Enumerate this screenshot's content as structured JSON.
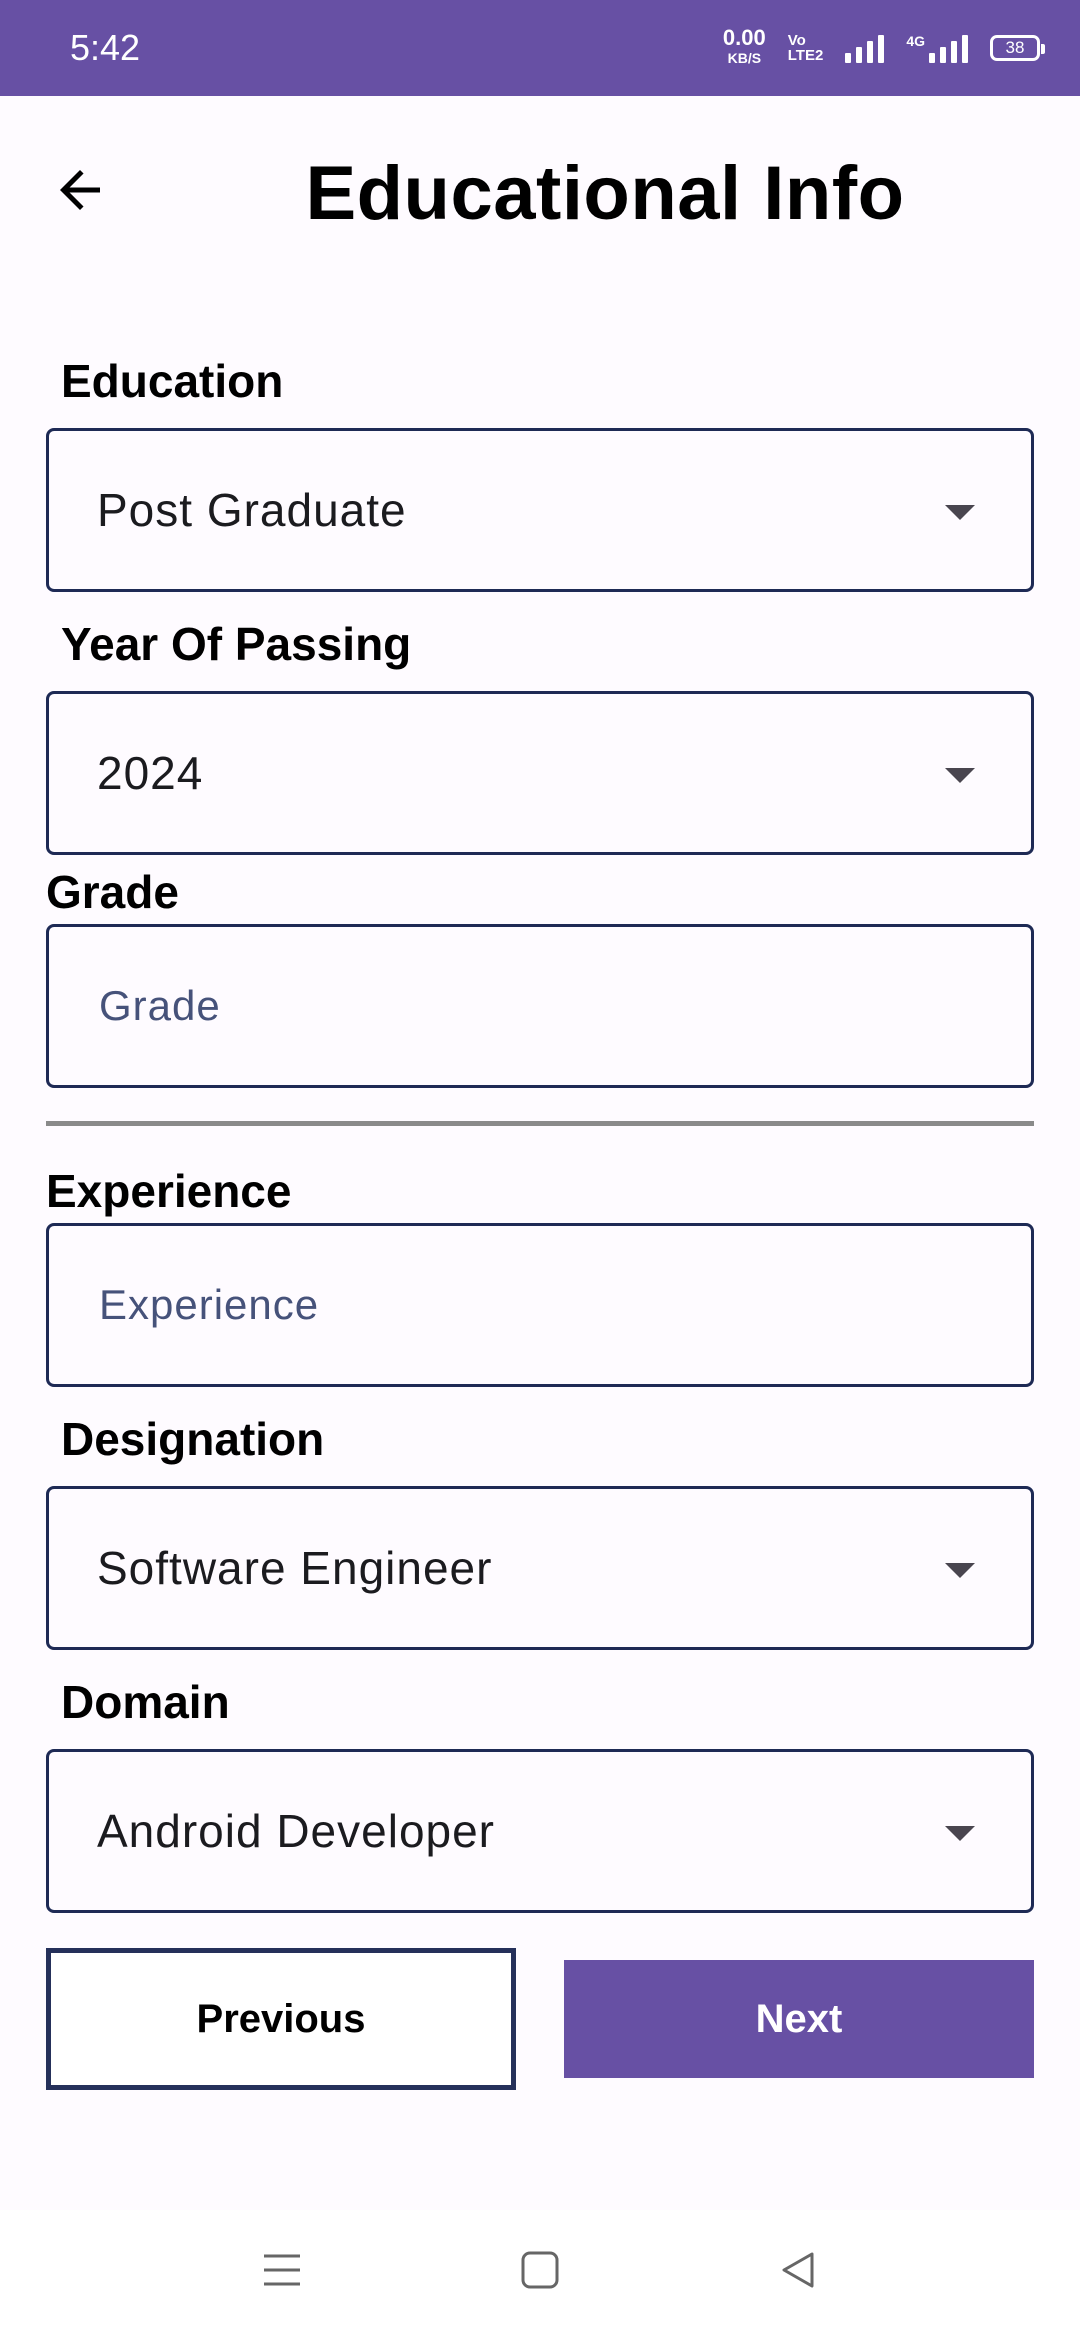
{
  "status_bar": {
    "time": "5:42",
    "net_speed_value": "0.00",
    "net_speed_unit": "KB/S",
    "volte_top": "Vo",
    "volte_bottom": "LTE2",
    "network_tag": "4G",
    "battery_level": "38"
  },
  "header": {
    "title": "Educational Info",
    "back_icon": "arrow-back-icon"
  },
  "form": {
    "education": {
      "label": "Education",
      "value": "Post Graduate"
    },
    "year_of_passing": {
      "label": "Year Of Passing",
      "value": "2024"
    },
    "grade": {
      "label": "Grade",
      "placeholder": "Grade"
    },
    "experience": {
      "label": "Experience",
      "placeholder": "Experience"
    },
    "designation": {
      "label": "Designation",
      "value": "Software Engineer"
    },
    "domain": {
      "label": "Domain",
      "value": "Android Developer"
    }
  },
  "actions": {
    "previous_label": "Previous",
    "next_label": "Next"
  },
  "colors": {
    "primary": "#6750a4",
    "outline": "#1e2a55",
    "background": "#fefbff"
  },
  "nav_bar": {
    "icons": [
      "menu-icon",
      "home-square-icon",
      "back-triangle-icon"
    ]
  }
}
